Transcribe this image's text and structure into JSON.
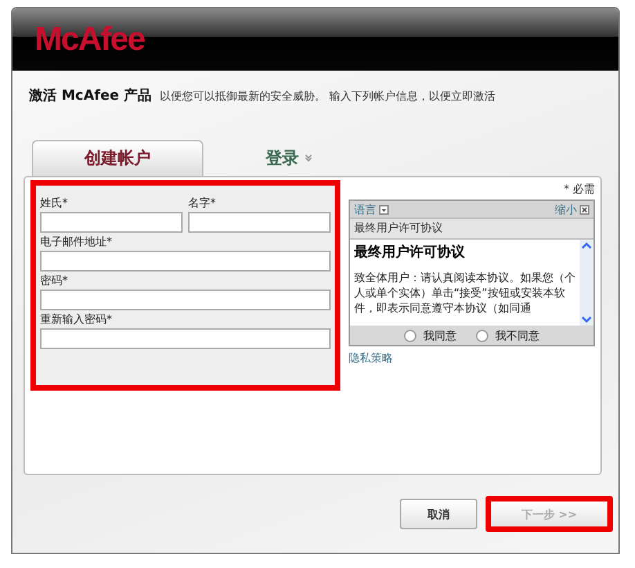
{
  "brand": "McAfee",
  "intro": {
    "title": "激活 McAfee 产品",
    "text": "以便您可以抵御最新的安全威胁。 输入下列帐户信息，以便立即激活"
  },
  "tabs": [
    {
      "label": "创建帐户",
      "selected": true
    },
    {
      "label": "登录",
      "selected": false
    }
  ],
  "required_note": "* 必需",
  "form": {
    "highlighted": true,
    "fields": [
      {
        "label": "姓氏*",
        "half": true
      },
      {
        "label": "名字*",
        "half": true
      },
      {
        "label": "电子邮件地址*",
        "half": false
      },
      {
        "label": "密码*",
        "half": false
      },
      {
        "label": "重新输入密码*",
        "half": false
      }
    ]
  },
  "eula": {
    "language": "语言",
    "collapse": "缩小",
    "title_bar": "最终用户许可协议",
    "heading": "最终用户许可协议",
    "body": "致全体用户：请认真阅读本协议。如果您（个人或单个实体）单击“接受”按钮或安装本软件，即表示同意遵守本协议（如同通",
    "options": [
      {
        "label": "我同意",
        "selected": false
      },
      {
        "label": "我不同意",
        "selected": false
      }
    ]
  },
  "privacy_link": "隐私策略",
  "buttons": [
    {
      "label": "取消",
      "disabled": false,
      "highlighted": false
    },
    {
      "label": "下一步 >>",
      "disabled": true,
      "highlighted": true
    }
  ]
}
